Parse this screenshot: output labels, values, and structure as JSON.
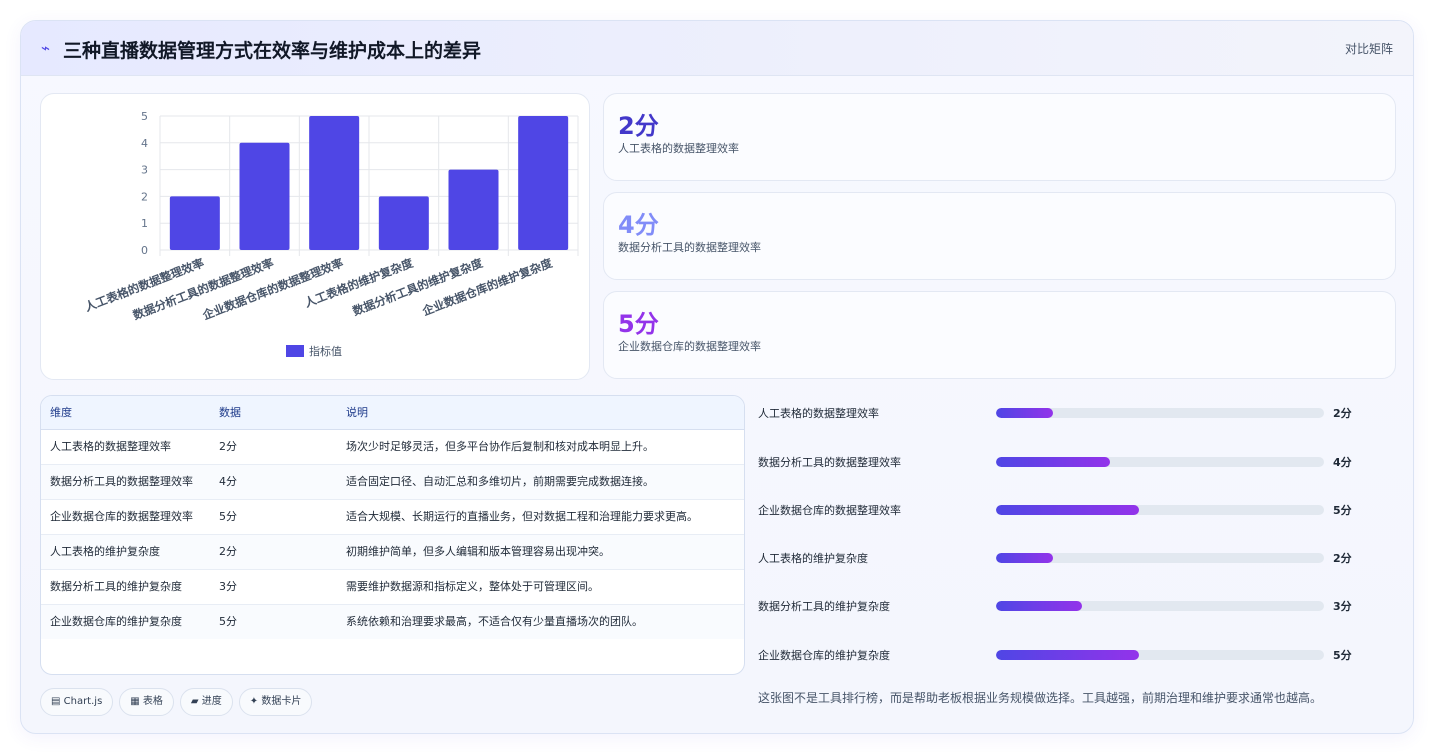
{
  "header": {
    "icon": "trend-icon",
    "icon_glyph": "⌁",
    "title": "三种直播数据管理方式在效率与维护成本上的差异",
    "tag": "对比矩阵"
  },
  "chart_data": {
    "type": "bar",
    "categories": [
      "人工表格的数据整理效率",
      "数据分析工具的数据整理效率",
      "企业数据仓库的数据整理效率",
      "人工表格的维护复杂度",
      "数据分析工具的维护复杂度",
      "企业数据仓库的维护复杂度"
    ],
    "series": [
      {
        "name": "指标值",
        "values": [
          2,
          4,
          5,
          2,
          3,
          5
        ],
        "color": "#4f46e5"
      }
    ],
    "ylim": [
      0,
      5
    ],
    "yticks": [
      "0",
      "1",
      "2",
      "3",
      "4",
      "5"
    ],
    "grid": true,
    "legend": "bottom"
  },
  "stats": [
    {
      "value": "2分",
      "label": "人工表格的数据整理效率",
      "color": "#4338ca"
    },
    {
      "value": "4分",
      "label": "数据分析工具的数据整理效率",
      "color": "#818cf8"
    },
    {
      "value": "5分",
      "label": "企业数据仓库的数据整理效率",
      "color": "#9333ea"
    }
  ],
  "table": {
    "headers": [
      "维度",
      "数据",
      "说明"
    ],
    "rows": [
      [
        "人工表格的数据整理效率",
        "2分",
        "场次少时足够灵活，但多平台协作后复制和核对成本明显上升。"
      ],
      [
        "数据分析工具的数据整理效率",
        "4分",
        "适合固定口径、自动汇总和多维切片，前期需要完成数据连接。"
      ],
      [
        "企业数据仓库的数据整理效率",
        "5分",
        "适合大规模、长期运行的直播业务，但对数据工程和治理能力要求更高。"
      ],
      [
        "人工表格的维护复杂度",
        "2分",
        "初期维护简单，但多人编辑和版本管理容易出现冲突。"
      ],
      [
        "数据分析工具的维护复杂度",
        "3分",
        "需要维护数据源和指标定义，整体处于可管理区间。"
      ],
      [
        "企业数据仓库的维护复杂度",
        "5分",
        "系统依赖和治理要求最高，不适合仅有少量直播场次的团队。"
      ]
    ]
  },
  "progress": [
    {
      "label": "人工表格的数据整理效率",
      "value": "2分",
      "fraction": 0.174
    },
    {
      "label": "数据分析工具的数据整理效率",
      "value": "4分",
      "fraction": 0.348
    },
    {
      "label": "企业数据仓库的数据整理效率",
      "value": "5分",
      "fraction": 0.435
    },
    {
      "label": "人工表格的维护复杂度",
      "value": "2分",
      "fraction": 0.174
    },
    {
      "label": "数据分析工具的维护复杂度",
      "value": "3分",
      "fraction": 0.261
    },
    {
      "label": "企业数据仓库的维护复杂度",
      "value": "5分",
      "fraction": 0.435
    }
  ],
  "note": "这张图不是工具排行榜，而是帮助老板根据业务规模做选择。工具越强，前期治理和维护要求通常也越高。",
  "pills": [
    "▤ Chart.js",
    "▦ 表格",
    "▰ 进度",
    "✦ 数据卡片"
  ]
}
